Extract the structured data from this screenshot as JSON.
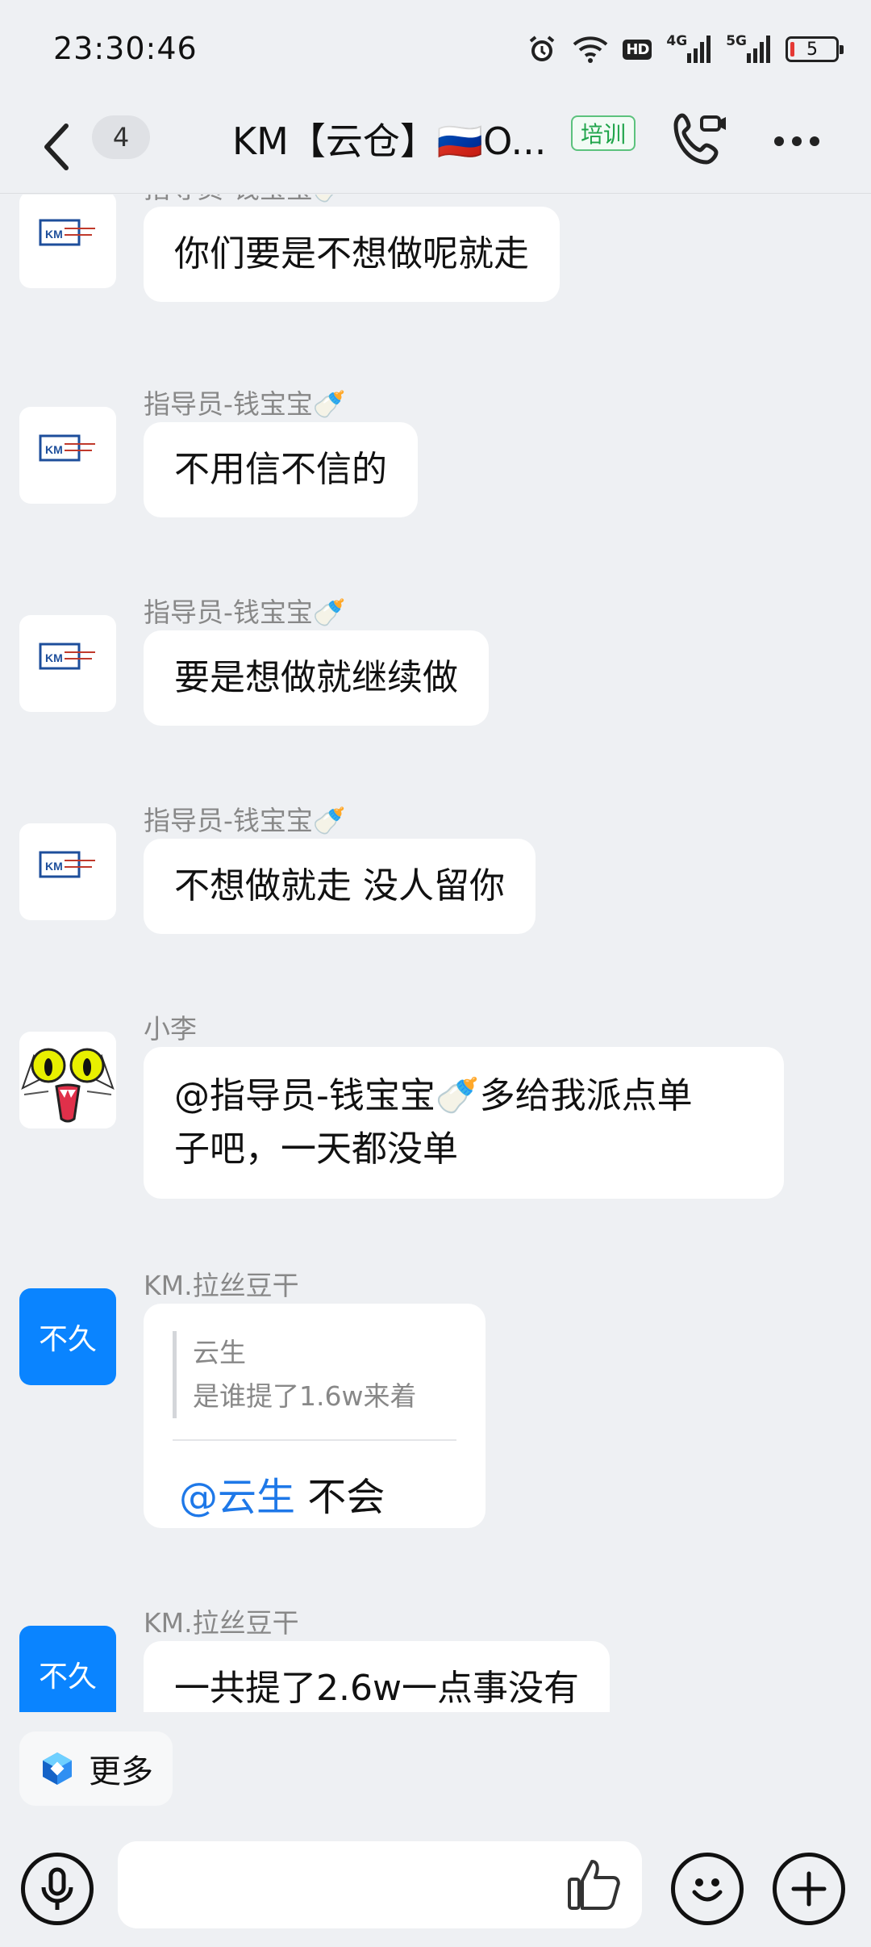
{
  "status_bar": {
    "time": "23:30:46",
    "hd": "HD",
    "net1": "4G",
    "net2": "5G",
    "battery": "5"
  },
  "header": {
    "unread_count": "4",
    "title": "KM【云仓】🇷🇺O...",
    "tag": "培训"
  },
  "messages": [
    {
      "sender": "指导员-钱宝宝🍼",
      "text": "你们要是不想做呢就走"
    },
    {
      "sender": "指导员-钱宝宝🍼",
      "text": "不用信不信的"
    },
    {
      "sender": "指导员-钱宝宝🍼",
      "text": "要是想做就继续做"
    },
    {
      "sender": "指导员-钱宝宝🍼",
      "text": "不想做就走 没人留你"
    },
    {
      "sender": "小李",
      "line1": "@指导员-钱宝宝🍼多给我派点单",
      "line2": "子吧，一天都没单"
    },
    {
      "sender": "KM.拉丝豆干",
      "avatar_text": "不久",
      "quote_name": "云生",
      "quote_text": "是谁提了1.6w来着",
      "mention": "@云生",
      "reply": " 不会"
    },
    {
      "sender": "KM.拉丝豆干",
      "avatar_text": "不久",
      "text": "一共提了2.6w一点事没有"
    }
  ],
  "more_button": {
    "label": "更多"
  },
  "input": {
    "placeholder": ""
  },
  "colors": {
    "accent": "#0a84ff",
    "mention": "#1e78e8",
    "tag_green": "#1fa44a",
    "background": "#eef0f3"
  },
  "icons": {
    "back": "chevron-left-icon",
    "call": "phone-video-icon",
    "more": "more-dots-icon",
    "voice": "microphone-icon",
    "like": "thumbs-up-icon",
    "emoji": "emoji-smile-icon",
    "add": "plus-icon"
  }
}
